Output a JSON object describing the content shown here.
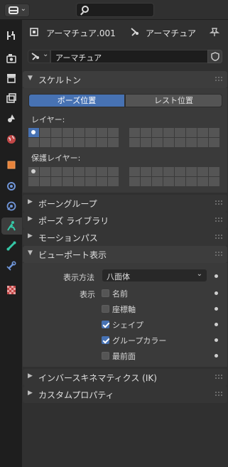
{
  "header": {
    "editor_type_icon": "properties-editor-icon",
    "search_placeholder": ""
  },
  "tabs": [
    {
      "name": "tool",
      "icon": "tool-icon"
    },
    {
      "name": "render",
      "icon": "render-icon"
    },
    {
      "name": "output",
      "icon": "output-icon"
    },
    {
      "name": "view-layer",
      "icon": "view-layer-icon"
    },
    {
      "name": "scene",
      "icon": "scene-icon"
    },
    {
      "name": "world",
      "icon": "world-icon"
    },
    {
      "name": "object",
      "icon": "object-icon"
    },
    {
      "name": "modifiers",
      "icon": "modifier-icon"
    },
    {
      "name": "physics",
      "icon": "physics-icon"
    },
    {
      "name": "armature-data",
      "icon": "armature-icon",
      "active": true
    },
    {
      "name": "bone",
      "icon": "bone-icon"
    },
    {
      "name": "bone-constraints",
      "icon": "bone-constraint-icon"
    },
    {
      "name": "texture",
      "icon": "texture-icon"
    }
  ],
  "breadcrumb": {
    "object": "アーマチュア.001",
    "data": "アーマチュア"
  },
  "datablock": {
    "name": "アーマチュア"
  },
  "sections": {
    "skeleton": {
      "title": "スケルトン",
      "pose_position": "ポーズ位置",
      "rest_position": "レスト位置",
      "layers_label": "レイヤー:",
      "protected_label": "保護レイヤー:"
    },
    "bone_groups": "ボーングループ",
    "pose_library": "ポーズ ライブラリ",
    "motion_paths": "モーションパス",
    "viewport_display": {
      "title": "ビューポート表示",
      "display_as_label": "表示方法",
      "display_as_value": "八面体",
      "show_label": "表示",
      "options": [
        {
          "label": "名前",
          "checked": false
        },
        {
          "label": "座標軸",
          "checked": false
        },
        {
          "label": "シェイプ",
          "checked": true
        },
        {
          "label": "グループカラー",
          "checked": true
        },
        {
          "label": "最前面",
          "checked": false
        }
      ]
    },
    "inverse_kinematics": "インバースキネマティクス (IK)",
    "custom_properties": "カスタムプロパティ"
  },
  "colors": {
    "accent": "#4772b3",
    "background": "#303030",
    "tab_column": "#1e1e1e"
  }
}
